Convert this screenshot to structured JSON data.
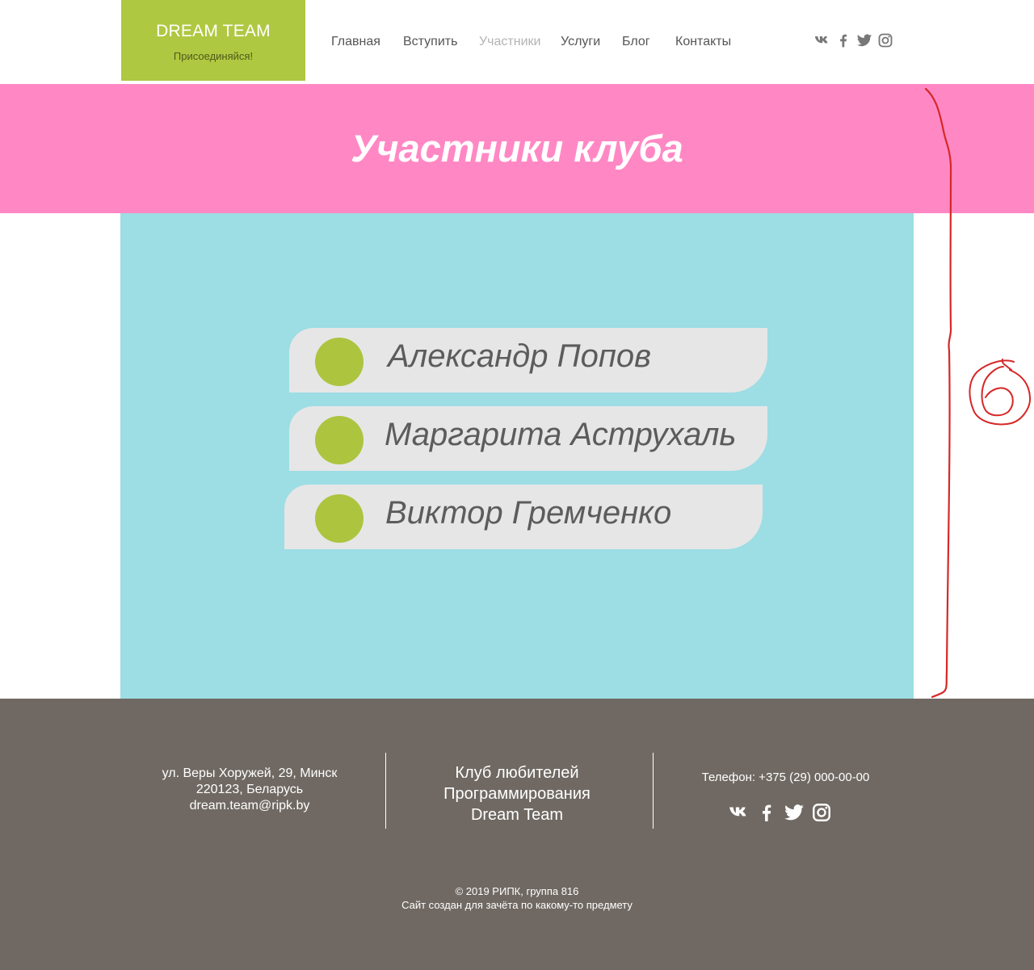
{
  "header": {
    "logo_title": "DREAM TEAM",
    "logo_subtitle": "Присоединяйся!",
    "nav": [
      {
        "label": "Главная"
      },
      {
        "label": "Вступить"
      },
      {
        "label": "Участники",
        "active": true
      },
      {
        "label": "Услуги"
      },
      {
        "label": "Блог"
      },
      {
        "label": "Контакты"
      }
    ],
    "social_icons": [
      "vk-icon",
      "facebook-icon",
      "twitter-icon",
      "instagram-icon"
    ]
  },
  "banner": {
    "title": "Участники клуба"
  },
  "members": [
    {
      "name": "Александр Попов"
    },
    {
      "name": "Маргарита Аструхаль"
    },
    {
      "name": "Виктор Гремченко"
    }
  ],
  "annotation": {
    "label": "6"
  },
  "footer": {
    "address": [
      "ул. Веры Хоружей, 29, Минск",
      "220123, Беларусь",
      "dream.team@ripk.by"
    ],
    "club": [
      "Клуб любителей",
      "Программирования",
      "Dream Team"
    ],
    "phone": "Телефон: +375 (29) 000-00-00",
    "social_icons": [
      "vk-icon",
      "facebook-icon",
      "twitter-icon",
      "instagram-icon"
    ],
    "copyright": [
      "© 2019 РИПК, группа 816",
      "Сайт создан для зачёта по какому-то предмету"
    ]
  },
  "colors": {
    "logo_green": "#aec841",
    "banner_pink": "#ff88c4",
    "panel_cyan": "#9ddde4",
    "member_bg": "#e6e6e6",
    "dot_green": "#adc43f",
    "footer_gray": "#706963",
    "annotation_red": "#d62828"
  }
}
